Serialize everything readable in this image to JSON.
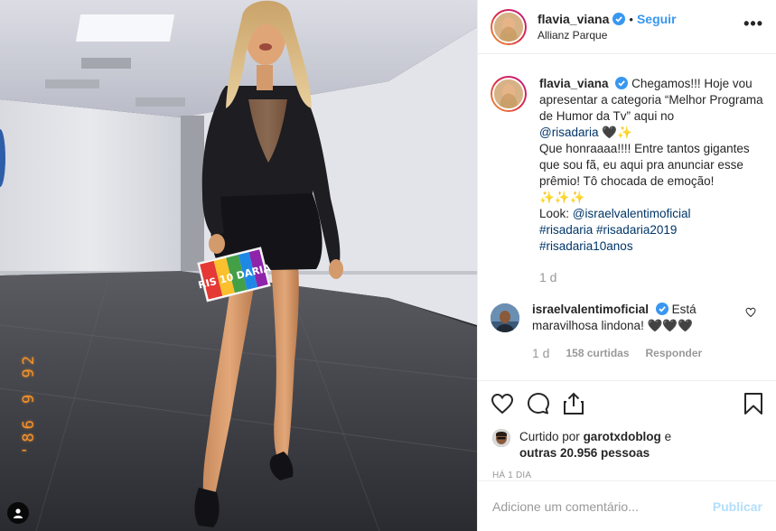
{
  "post": {
    "photo_date_stamp": "'86 9 92",
    "photo_card_text": "RIS 10 DARIA"
  },
  "header": {
    "username": "flavia_viana",
    "separator": "•",
    "follow_label": "Seguir",
    "location": "Allianz Parque",
    "more_icon": "•••"
  },
  "caption": {
    "username": "flavia_viana",
    "line1": "Chegamos!!! Hoje vou apresentar a categoria “Melhor Programa de Humor da Tv” aqui no",
    "mention": "@risadaria",
    "emoji1": "🖤✨",
    "line2": "Que honraaaa!!!! Entre tantos gigantes que sou fã, eu aqui pra anunciar esse prêmio! Tô chocada de emoção!",
    "emoji2": "✨✨✨",
    "look_label": "Look:",
    "look_mention": "@israelvalentimoficial",
    "hashtag1": "#risadaria",
    "hashtag2": "#risadaria2019",
    "hashtag3": "#risadaria10anos",
    "time": "1 d"
  },
  "comment": {
    "username": "israelvalentimoficial",
    "text": "Está maravilhosa lindona! 🖤🖤🖤",
    "time": "1 d",
    "likes": "158 curtidas",
    "reply_label": "Responder"
  },
  "actions": {
    "like_icon": "heart-outline-icon",
    "comment_icon": "comment-bubble-icon",
    "share_icon": "share-icon",
    "save_icon": "bookmark-icon"
  },
  "likes": {
    "prefix": "Curtido por",
    "user": "garotxdoblog",
    "middle": "e",
    "others": "outras 20.956 pessoas"
  },
  "posted_ago": "HÁ 1 DIA",
  "add_comment": {
    "placeholder": "Adicione um comentário...",
    "publish_label": "Publicar"
  },
  "colors": {
    "accent": "#3897f0",
    "link": "#003569",
    "muted": "#999999",
    "publish_disabled": "#b2dffc",
    "date_stamp": "#f7932a"
  }
}
